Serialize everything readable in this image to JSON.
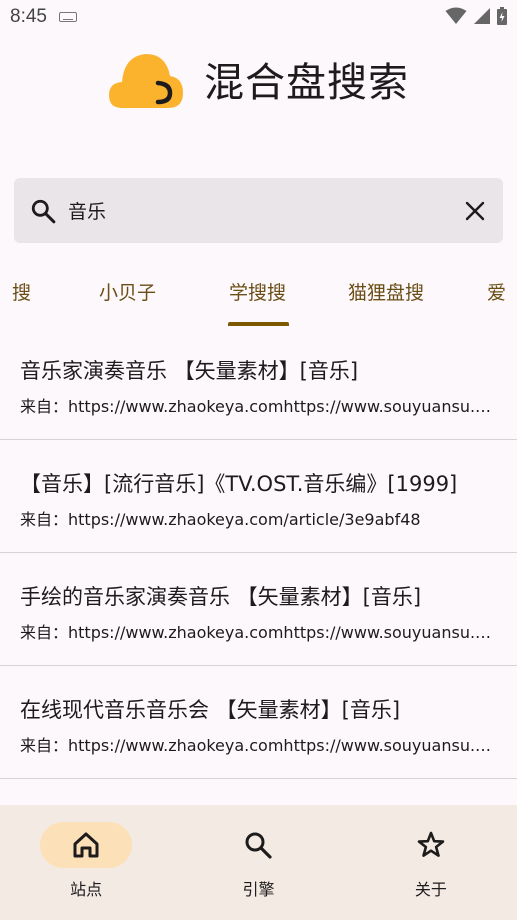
{
  "status_bar": {
    "time": "8:45"
  },
  "header": {
    "title": "混合盘搜索"
  },
  "search": {
    "value": "音乐",
    "placeholder": ""
  },
  "tabs": [
    {
      "label": "搜"
    },
    {
      "label": "小贝子"
    },
    {
      "label": "学搜搜",
      "active": true
    },
    {
      "label": "猫狸盘搜"
    },
    {
      "label": "爱"
    }
  ],
  "results": [
    {
      "title": "音乐家演奏音乐 【矢量素材】[音乐]",
      "source": "来自：https://www.zhaokeya.comhttps://www.souyuansu.com/..."
    },
    {
      "title": "【音乐】[流行音乐]《TV.OST.音乐编》[1999]",
      "source": "来自：https://www.zhaokeya.com/article/3e9abf48"
    },
    {
      "title": "手绘的音乐家演奏音乐 【矢量素材】[音乐]",
      "source": "来自：https://www.zhaokeya.comhttps://www.souyuansu.com/..."
    },
    {
      "title": "在线现代音乐音乐会 【矢量素材】[音乐]",
      "source": "来自：https://www.zhaokeya.comhttps://www.souyuansu.com/..."
    }
  ],
  "bottom_nav": [
    {
      "label": "站点",
      "icon": "home-icon",
      "active": true
    },
    {
      "label": "引擎",
      "icon": "search-icon"
    },
    {
      "label": "关于",
      "icon": "star-icon"
    }
  ],
  "colors": {
    "accent": "#7c5800",
    "tab_text": "#6b4e16",
    "logo": "#fbb32e",
    "nav_active": "#fce0b8",
    "nav_bg": "#f3ebe3"
  }
}
